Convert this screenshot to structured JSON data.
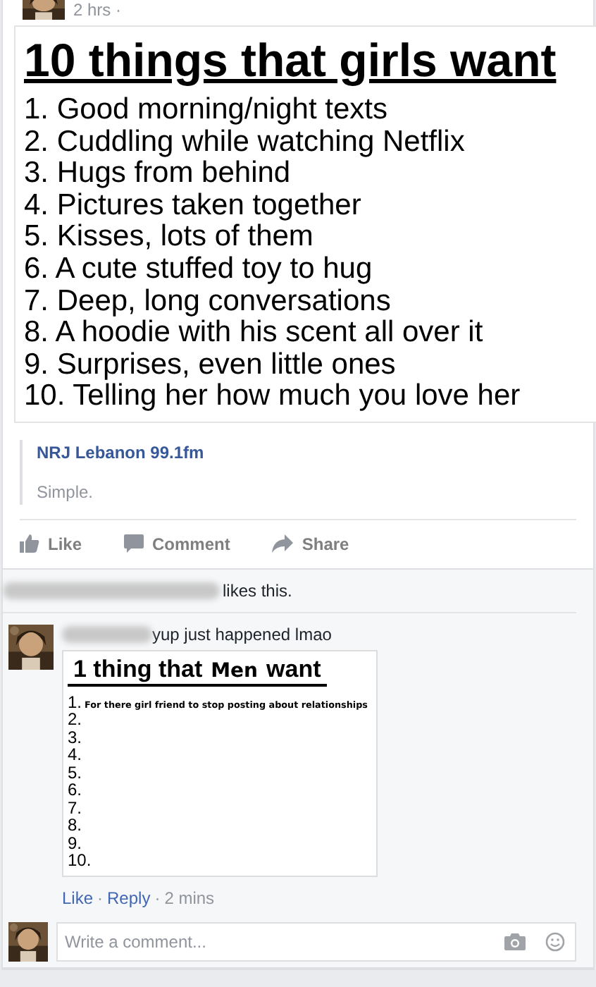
{
  "post": {
    "time": "2 hrs ·",
    "image": {
      "title": "10 things that girls want",
      "items": [
        "1. Good morning/night texts",
        "2. Cuddling while watching Netflix",
        "3. Hugs from behind",
        "4. Pictures taken together",
        "5. Kisses, lots of them",
        "6. A cute stuffed toy to hug",
        "7. Deep, long conversations",
        "8. A hoodie with his scent all over it",
        "9. Surprises, even little ones",
        "10. Telling her how much you love her"
      ]
    },
    "link": {
      "source": "NRJ Lebanon 99.1fm",
      "caption": "Simple."
    },
    "actions": [
      {
        "kind": "like",
        "label": "Like"
      },
      {
        "kind": "comment",
        "label": "Comment"
      },
      {
        "kind": "share",
        "label": "Share"
      }
    ]
  },
  "likes": {
    "text": "likes this."
  },
  "comment": {
    "text": "yup just happened lmao",
    "image": {
      "title_start": "1 thing that",
      "title_word": "Men",
      "title_end": "want",
      "items": [
        {
          "number": "1.",
          "text": "For there girl friend to stop posting about relationships"
        },
        {
          "number": "2."
        },
        {
          "number": "3."
        },
        {
          "number": "4."
        },
        {
          "number": "5."
        },
        {
          "number": "6."
        },
        {
          "number": "7."
        },
        {
          "number": "8."
        },
        {
          "number": "9."
        },
        {
          "number": "10."
        }
      ]
    },
    "actions": [
      {
        "kind": "link",
        "label": "Like"
      },
      {
        "kind": "separator",
        "label": "·"
      },
      {
        "kind": "link",
        "label": "Reply"
      },
      {
        "kind": "separator",
        "label": "·"
      },
      {
        "kind": "plain",
        "label": "2 mins"
      }
    ]
  },
  "composer": {
    "placeholder": "Write a comment..."
  }
}
